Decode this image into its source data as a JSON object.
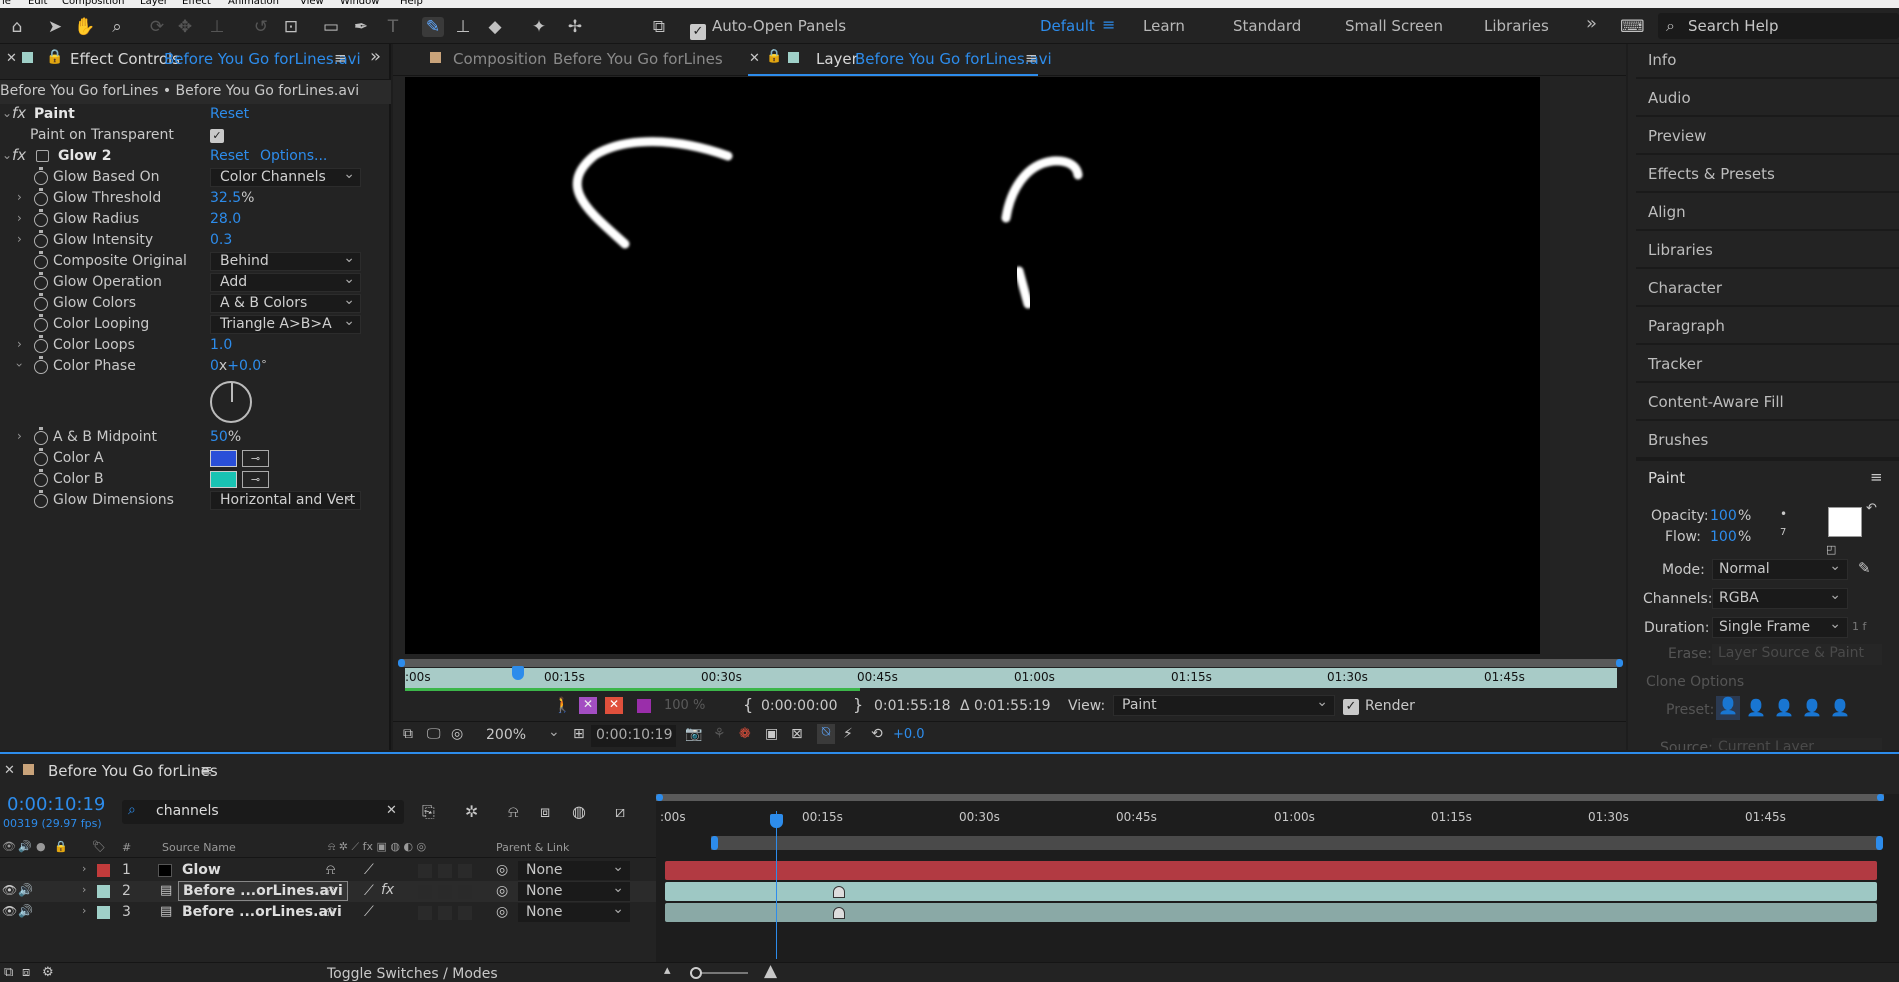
{
  "toolbar": {
    "auto_open_label": "Auto-Open Panels",
    "workspaces": [
      "Default",
      "Learn",
      "Standard",
      "Small Screen",
      "Libraries"
    ],
    "more": "»",
    "search_placeholder": "Search Help"
  },
  "effects_panel": {
    "tab_label": "Effect Controls",
    "tab_file": "Before You Go forLines.avi",
    "path": "Before You Go forLines • Before You Go forLines.avi",
    "paint": {
      "name": "Paint",
      "reset": "Reset",
      "transparent_label": "Paint on Transparent"
    },
    "glow": {
      "name": "Glow 2",
      "reset": "Reset",
      "options": "Options..."
    },
    "props": [
      {
        "label": "Glow Based On",
        "value": "Color Channels"
      },
      {
        "label": "Glow Threshold",
        "value": "32.5",
        "unit": "%"
      },
      {
        "label": "Glow Radius",
        "value": "28.0"
      },
      {
        "label": "Glow Intensity",
        "value": "0.3"
      },
      {
        "label": "Composite Original",
        "value": "Behind"
      },
      {
        "label": "Glow Operation",
        "value": "Add"
      },
      {
        "label": "Glow Colors",
        "value": "A & B Colors"
      },
      {
        "label": "Color Looping",
        "value": "Triangle A>B>A"
      },
      {
        "label": "Color Loops",
        "value": "1.0"
      },
      {
        "label": "Color Phase",
        "value": "0",
        "value2": "+0.0",
        "unit": "x",
        "unit2": "°"
      },
      {
        "label": "A & B Midpoint",
        "value": "50",
        "unit": "%"
      },
      {
        "label": "Color A",
        "color": "#2a4fd8"
      },
      {
        "label": "Color B",
        "color": "#19c3b3"
      },
      {
        "label": "Glow Dimensions",
        "value": "Horizontal and Vert"
      }
    ]
  },
  "comp_panel": {
    "tab1_label": "Composition",
    "tab1_name": "Before You Go forLines",
    "tab2_label": "Layer",
    "tab2_name": "Before You Go forLines.avi",
    "ruler_ticks": [
      ":00s",
      "00:15s",
      "00:30s",
      "00:45s",
      "01:00s",
      "01:15s",
      "01:30s",
      "01:45s"
    ],
    "zoom_pct": "100 %",
    "time_in": "0:00:00:00",
    "time_out": "0:01:55:18",
    "duration": "Δ 0:01:55:19",
    "view_label": "View:",
    "view_value": "Paint",
    "render_label": "Render",
    "magnification": "200%",
    "current_time": "0:00:10:19",
    "exposure": "+0.0"
  },
  "right_panels": {
    "items": [
      "Info",
      "Audio",
      "Preview",
      "Effects & Presets",
      "Align",
      "Libraries",
      "Character",
      "Paragraph",
      "Tracker",
      "Content-Aware Fill",
      "Brushes"
    ],
    "paint": {
      "title": "Paint",
      "opacity_label": "Opacity:",
      "opacity_value": "100",
      "opacity_unit": "%",
      "flow_label": "Flow:",
      "flow_value": "100",
      "flow_unit": "%",
      "brush_dot": "•",
      "brush_size": "7",
      "mode_label": "Mode:",
      "mode_value": "Normal",
      "channels_label": "Channels:",
      "channels_value": "RGBA",
      "duration_label": "Duration:",
      "duration_value": "Single Frame",
      "duration_suffix": "1 f",
      "erase_label": "Erase:",
      "erase_value": "Layer Source & Paint",
      "clone_label": "Clone Options",
      "preset_label": "Preset:",
      "source_label": "Source:",
      "source_value": "Current Layer"
    }
  },
  "timeline": {
    "tab_name": "Before You Go forLines",
    "current_time": "0:00:10:19",
    "frames": "00319 (29.97 fps)",
    "search_value": "channels",
    "col_hash": "#",
    "col_source": "Source Name",
    "col_parent": "Parent & Link",
    "ruler_ticks": [
      ":00s",
      "00:15s",
      "00:30s",
      "00:45s",
      "01:00s",
      "01:15s",
      "01:30s",
      "01:45s"
    ],
    "layers": [
      {
        "num": "1",
        "name": "Glow",
        "label_color": "#c23b3b",
        "parent": "None"
      },
      {
        "num": "2",
        "name": "Before ...orLines.avi",
        "label_color": "#9fd0c8",
        "parent": "None"
      },
      {
        "num": "3",
        "name": "Before ...orLines.avi",
        "label_color": "#9fd0c8",
        "parent": "None"
      }
    ],
    "toggle_label": "Toggle Switches / Modes"
  }
}
